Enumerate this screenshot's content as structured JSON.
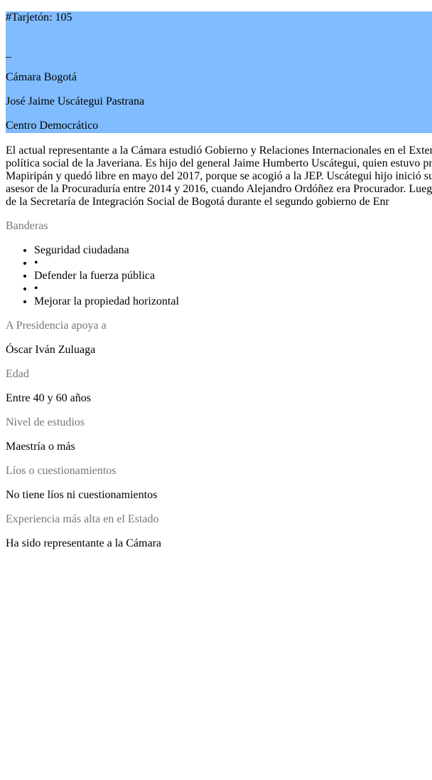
{
  "card": {
    "ballot": "#Tarjetón: 105",
    "underscore": "_",
    "chamber": "Cámara Bogotá",
    "name": "José Jaime Uscátegui Pastrana",
    "party": "Centro Democrático",
    "background_color": "#80bcff"
  },
  "bio_lines": [
    "El actual representante a la Cámara estudió Gobierno y Relaciones Internacionales en el Exter",
    "política social de la Javeriana. Es hijo del general Jaime Humberto Uscátegui, quien estuvo pr",
    "Mapiripán y quedó libre en mayo del 2017, porque se acogió a la JEP. Uscátegui hijo inició su",
    "asesor de la Procuraduría entre 2014 y 2016, cuando Alejandro Ordóñez era Procurador. Lueg",
    "de la Secretaría de Integración Social de Bogotá durante el segundo gobierno de Enr"
  ],
  "banderas": {
    "label": "Banderas",
    "items": [
      "Seguridad ciudadana",
      "•",
      "Defender la fuerza pública",
      "•",
      "Mejorar la propiedad horizontal"
    ]
  },
  "fields": [
    {
      "label": "A Presidencia apoya a",
      "value": "Óscar Iván Zuluaga"
    },
    {
      "label": "Edad",
      "value": "Entre 40 y 60 años"
    },
    {
      "label": "Nivel de estudios",
      "value": "Maestría o más"
    },
    {
      "label": "Líos o cuestionamientos",
      "value": "No tiene líos ni cuestionamientos"
    },
    {
      "label": "Experiencia más alta en el Estado",
      "value": "Ha sido representante a la Cámara"
    }
  ],
  "label_color": "#777777"
}
